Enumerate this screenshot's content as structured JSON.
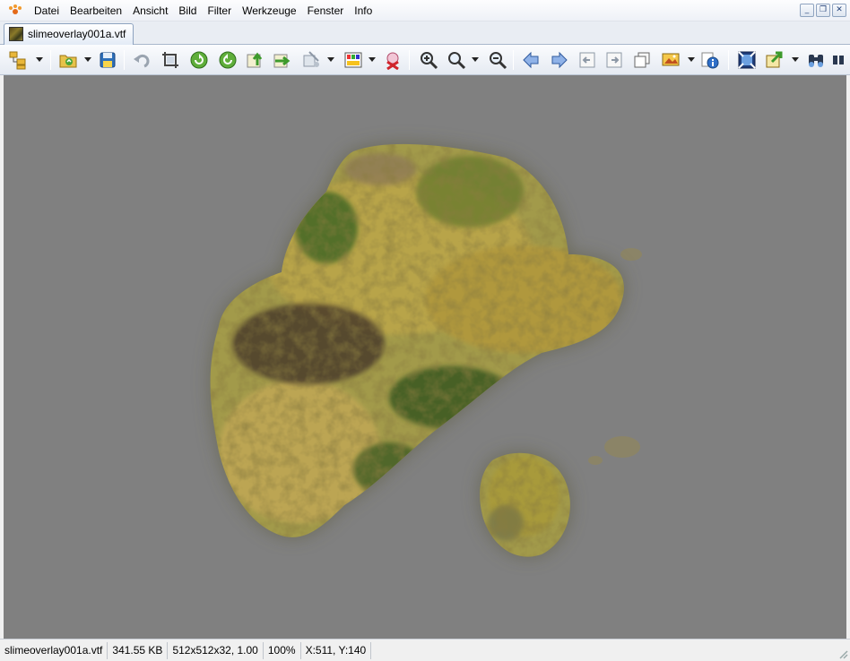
{
  "menu": {
    "items": [
      "Datei",
      "Bearbeiten",
      "Ansicht",
      "Bild",
      "Filter",
      "Werkzeuge",
      "Fenster",
      "Info"
    ]
  },
  "window_controls": {
    "minimize": "_",
    "restore": "❐",
    "close": "✕"
  },
  "tab": {
    "label": "slimeoverlay001a.vtf"
  },
  "toolbar": {
    "icons": [
      "browser-icon",
      "open-icon",
      "save-icon",
      "undo-icon",
      "crop-icon",
      "rotate-left-icon",
      "rotate-right-icon",
      "flip-vertical-icon",
      "flip-horizontal-icon",
      "effects-icon",
      "colors-icon",
      "delete-icon",
      "zoom-in-icon",
      "zoom-icon",
      "zoom-out-icon",
      "previous-icon",
      "next-icon",
      "first-page-icon",
      "last-page-icon",
      "copy-icon",
      "slideshow-icon",
      "info-icon",
      "fullscreen-icon",
      "export-icon",
      "search-icon"
    ]
  },
  "canvas": {
    "background": "#808080"
  },
  "status": {
    "filename": "slimeoverlay001a.vtf",
    "filesize": "341.55 KB",
    "dimensions": "512x512x32, 1.00",
    "zoom": "100%",
    "cursor": "X:511, Y:140"
  },
  "colors": {
    "accent": "#2f5a9e",
    "slime_light": "#a89a3a",
    "slime_dark": "#3e5a22"
  }
}
